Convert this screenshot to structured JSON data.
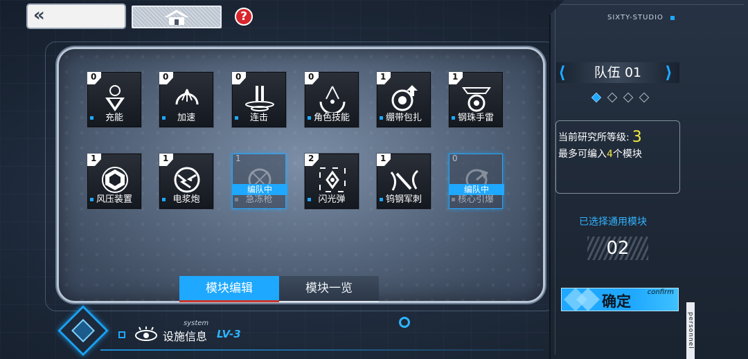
{
  "header": {
    "back_label": "«",
    "help_label": "?"
  },
  "cards": [
    {
      "count": "0",
      "label": "充能",
      "icon": "charge-icon",
      "tag": ""
    },
    {
      "count": "0",
      "label": "加速",
      "icon": "speed-icon",
      "tag": ""
    },
    {
      "count": "0",
      "label": "连击",
      "icon": "combo-icon",
      "tag": ""
    },
    {
      "count": "0",
      "label": "角色技能",
      "icon": "skill-icon",
      "tag": ""
    },
    {
      "count": "1",
      "label": "绷带包扎",
      "icon": "bandage-icon",
      "tag": ""
    },
    {
      "count": "1",
      "label": "钢珠手雷",
      "icon": "grenade-icon",
      "tag": ""
    },
    {
      "count": "1",
      "label": "风压装置",
      "icon": "wind-device-icon",
      "tag": ""
    },
    {
      "count": "1",
      "label": "电浆炮",
      "icon": "plasma-cannon-icon",
      "tag": ""
    },
    {
      "count": "1",
      "label": "急冻枪",
      "icon": "freeze-gun-icon",
      "tag": "编队中"
    },
    {
      "count": "2",
      "label": "闪光弹",
      "icon": "flashbang-icon",
      "tag": ""
    },
    {
      "count": "1",
      "label": "钨钢军刺",
      "icon": "bayonet-icon",
      "tag": ""
    },
    {
      "count": "0",
      "label": "核心引爆",
      "icon": "core-detonate-icon",
      "tag": "编队中"
    }
  ],
  "tabs": {
    "edit": "模块编辑",
    "list": "模块一览"
  },
  "system": {
    "small_label": "system",
    "title": "设施信息",
    "level": "LV-3"
  },
  "right_panel": {
    "studio": "SIXTY-STUDIO",
    "team_prefix": "队伍",
    "team_number": "01",
    "lab_level_label": "当前研究所等级:",
    "lab_level_value": "3",
    "max_modules_prefix": "最多可编入",
    "max_modules_value": "4",
    "max_modules_suffix": "个模块",
    "selected_title": "已选择通用模块",
    "selected_count": "02",
    "confirm_label": "确定",
    "confirm_sub": "confirm",
    "side_tag": "personnel"
  },
  "colors": {
    "accent": "#1ea8ff",
    "highlight": "#f3ea44"
  }
}
